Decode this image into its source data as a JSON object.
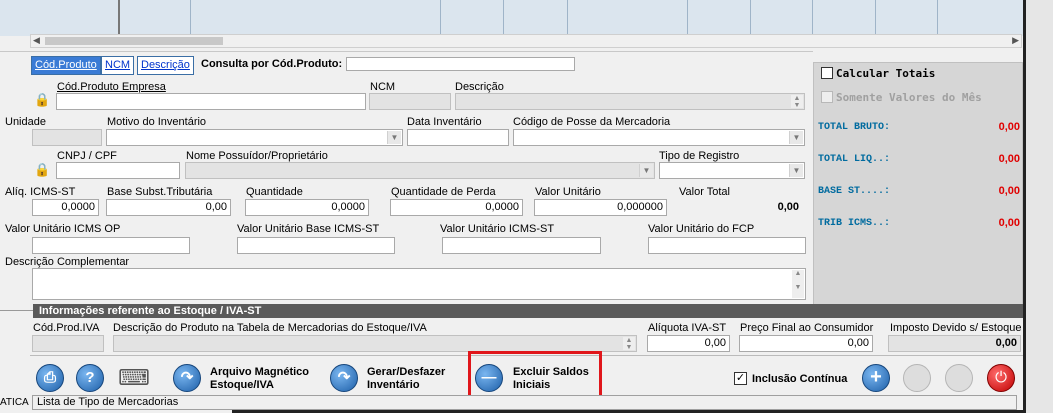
{
  "tabs": {
    "cod_produto": "Cód.Produto",
    "ncm": "NCM",
    "descricao": "Descrição",
    "consulta_label": "Consulta por Cód.Produto:"
  },
  "fields": {
    "cod_produto_empresa": {
      "label": "Cód.Produto Empresa",
      "value": ""
    },
    "ncm": {
      "label": "NCM",
      "value": ""
    },
    "descricao": {
      "label": "Descrição",
      "value": ""
    },
    "unidade": {
      "label": "Unidade",
      "value": ""
    },
    "motivo_inventario": {
      "label": "Motivo do Inventário",
      "value": ""
    },
    "data_inventario": {
      "label": "Data Inventário",
      "value": ""
    },
    "codigo_posse": {
      "label": "Código de Posse da Mercadoria",
      "value": ""
    },
    "cnpj_cpf": {
      "label": "CNPJ / CPF",
      "value": ""
    },
    "nome_possuidor": {
      "label": "Nome Possuídor/Proprietário",
      "value": ""
    },
    "tipo_registro": {
      "label": "Tipo de Registro",
      "value": ""
    },
    "aliq_icms_st": {
      "label": "Alíq. ICMS-ST",
      "value": "0,0000"
    },
    "base_subst": {
      "label": "Base Subst.Tributária",
      "value": "0,00"
    },
    "quantidade": {
      "label": "Quantidade",
      "value": "0,0000"
    },
    "quantidade_perda": {
      "label": "Quantidade de Perda",
      "value": "0,0000"
    },
    "valor_unitario": {
      "label": "Valor Unitário",
      "value": "0,000000"
    },
    "valor_total": {
      "label": "Valor Total",
      "value": "0,00"
    },
    "valor_unit_icms_op": {
      "label": "Valor Unitário ICMS OP",
      "value": ""
    },
    "valor_unit_base_icms_st": {
      "label": "Valor Unitário Base ICMS-ST",
      "value": ""
    },
    "valor_unit_icms_st": {
      "label": "Valor Unitário ICMS-ST",
      "value": ""
    },
    "valor_unit_fcp": {
      "label": "Valor Unitário do FCP",
      "value": ""
    },
    "descricao_complementar": {
      "label": "Descrição Complementar",
      "value": ""
    }
  },
  "estoque": {
    "title": "Informações referente ao Estoque / IVA-ST",
    "cod_prod_iva": {
      "label": "Cód.Prod.IVA",
      "value": ""
    },
    "descricao_tabela": {
      "label": "Descrição do Produto na Tabela de Mercadorias do Estoque/IVA",
      "value": ""
    },
    "aliquota_iva_st": {
      "label": "Alíquota IVA-ST",
      "value": "0,00"
    },
    "preco_final": {
      "label": "Preço Final ao Consumidor",
      "value": "0,00"
    },
    "imposto_devido": {
      "label": "Imposto Devido s/ Estoque",
      "value": "0,00"
    }
  },
  "totals": {
    "calcular_totais": "Calcular Totais",
    "somente_valores": "Somente Valores do Mês",
    "rows": [
      {
        "label": "TOTAL BRUTO:",
        "value": "0,00"
      },
      {
        "label": "TOTAL LIQ..:",
        "value": "0,00"
      },
      {
        "label": "BASE ST....:",
        "value": "0,00"
      },
      {
        "label": "TRIB ICMS..:",
        "value": "0,00"
      }
    ]
  },
  "toolbar": {
    "arquivo_line1": "Arquivo Magnético",
    "arquivo_line2": "Estoque/IVA",
    "gerar_line1": "Gerar/Desfazer",
    "gerar_line2": "Inventário",
    "excluir_line1": "Excluir Saldos",
    "excluir_line2": "Iniciais",
    "inclusao_continua": "Inclusão Contínua",
    "inclusao_checked": true
  },
  "status": {
    "text": "Lista de Tipo de Mercadorias",
    "left_text": "ATICA"
  },
  "colors": {
    "highlight_box": "#e0161b",
    "total_value": "#e00000",
    "total_label": "#006b9f",
    "tab_active": "#3a7bd5"
  }
}
